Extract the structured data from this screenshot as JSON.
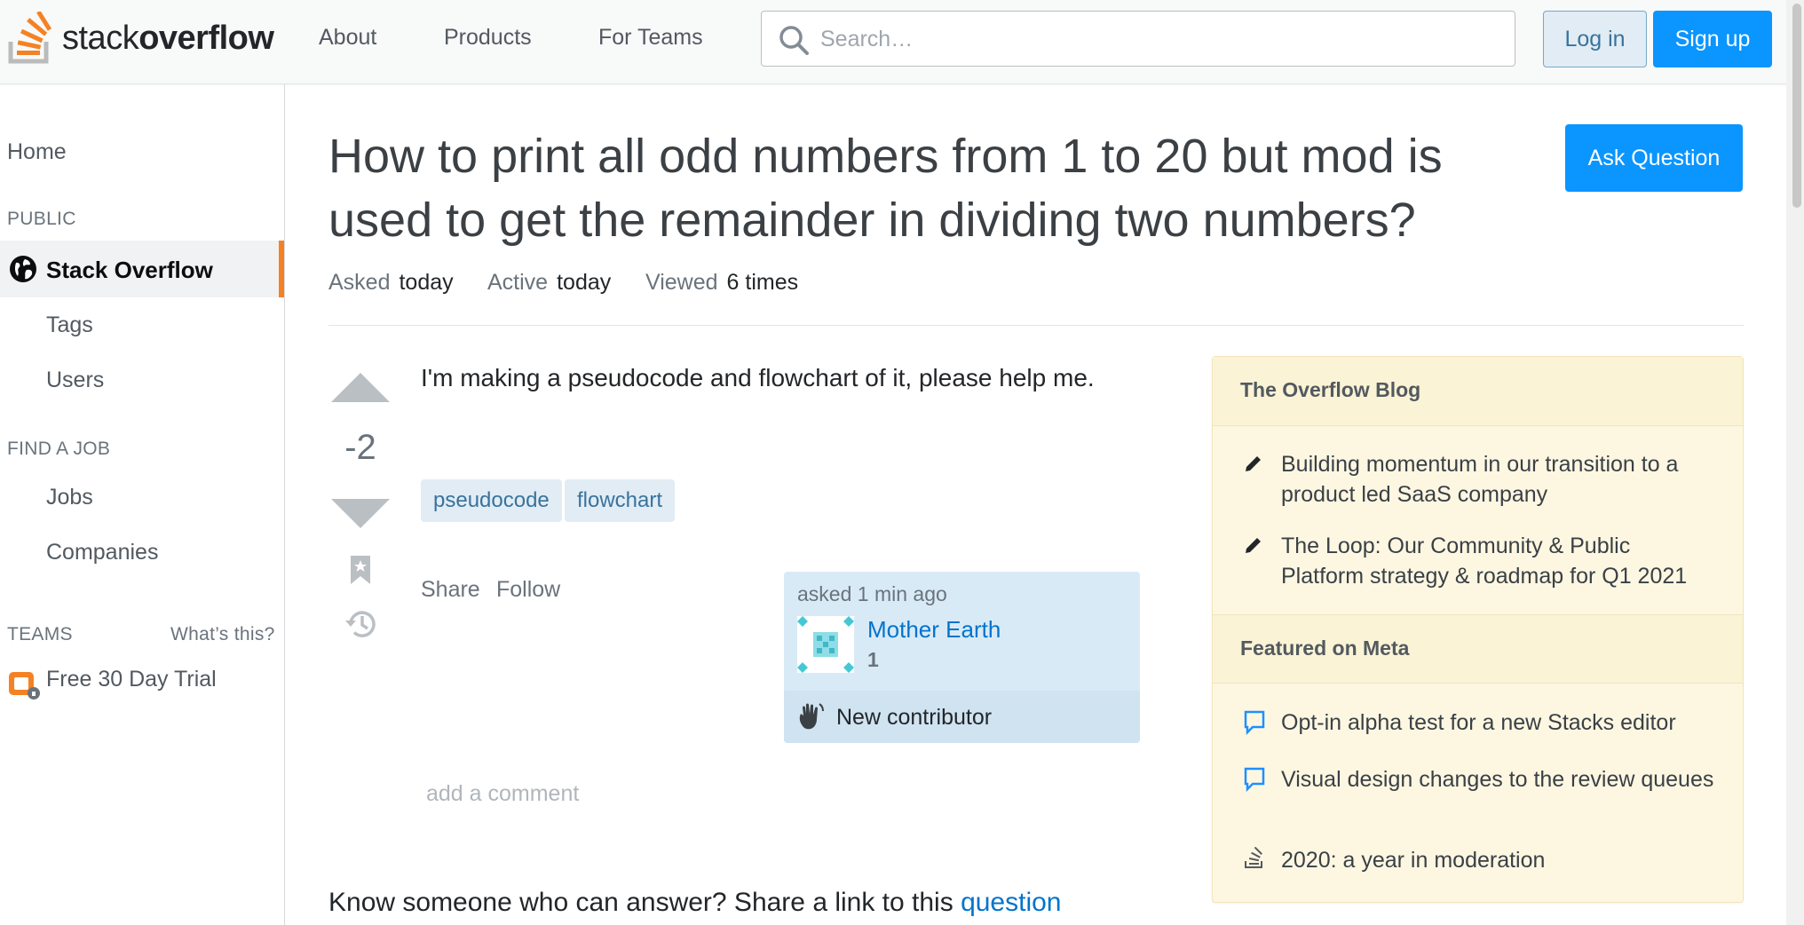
{
  "header": {
    "logo_text_light": "stack",
    "logo_text_bold": "overflow",
    "nav": [
      "About",
      "Products",
      "For Teams"
    ],
    "search_placeholder": "Search…",
    "login_label": "Log in",
    "signup_label": "Sign up"
  },
  "sidebar": {
    "home": "Home",
    "public_heading": "PUBLIC",
    "active_item": "Stack Overflow",
    "tags": "Tags",
    "users": "Users",
    "find_job_heading": "FIND A JOB",
    "jobs": "Jobs",
    "companies": "Companies",
    "teams_heading": "TEAMS",
    "whats_this": "What’s this?",
    "trial": "Free 30 Day Trial"
  },
  "question": {
    "title": "How to print all odd numbers from 1 to 20 but mod is used to get the remainder in dividing two numbers?",
    "ask_button": "Ask Question",
    "meta": [
      {
        "key": "Asked",
        "value": "today"
      },
      {
        "key": "Active",
        "value": "today"
      },
      {
        "key": "Viewed",
        "value": "6 times"
      }
    ],
    "votes": "-2",
    "body": "I'm making a pseudocode and flowchart of it, please help me.",
    "tags": [
      "pseudocode",
      "flowchart"
    ],
    "share": "Share",
    "follow": "Follow",
    "asked_time": "asked 1 min ago",
    "user_name": "Mother Earth",
    "user_rep": "1",
    "new_contributor": "New contributor",
    "add_comment": "add a comment",
    "know_prefix": "Know someone who can answer? Share a link to this ",
    "know_link": "question"
  },
  "widget": {
    "blog_heading": "The Overflow Blog",
    "blog_items": [
      "Building momentum in our transition to a product led SaaS company",
      "The Loop: Our Community & Public Platform strategy & roadmap for Q1 2021"
    ],
    "meta_heading": "Featured on Meta",
    "meta_items": [
      "Opt-in alpha test for a new Stacks editor",
      "Visual design changes to the review queues",
      "2020: a year in moderation"
    ]
  },
  "colors": {
    "accent_orange": "#f48225",
    "primary_blue": "#0a95ff",
    "link_blue": "#0074cc",
    "tag_bg": "#e1ecf4",
    "widget_bg": "#fdf7e2"
  }
}
